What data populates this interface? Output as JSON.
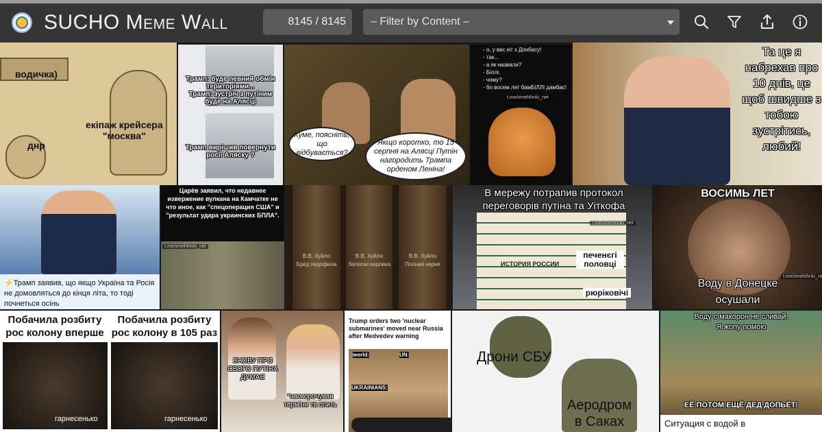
{
  "header": {
    "title": "SUCHO Meme Wall",
    "counter": "8145 / 8145",
    "filter_placeholder": "– Filter by Content –",
    "icons": [
      "search-icon",
      "filter-icon",
      "share-icon",
      "info-icon"
    ]
  },
  "colors": {
    "header_bg": "#353535",
    "control_bg": "#5a5a5a",
    "page_bg": "#1a1a1a"
  },
  "memes": {
    "m1": {
      "l1": "водичка)",
      "l2": "екіпаж крейсера\n\"москва\"",
      "l3": "днр"
    },
    "m2": {
      "top": "Трамп: буде певний обмін територіями...\nТрамп: зустріч з путіним буде на Алясці",
      "bottom": "Трамп вирішив повернути росії Аляску ?"
    },
    "m3": {
      "left": "Куме, поясніть, що відбувається?",
      "right": "Якщо коротко, то 15 серпня на Алясці Путін нагородить Трампа орденом Леніна!"
    },
    "m4": {
      "text": "- о, у вас кіт з Донбасу!\n- так...\n- а як назвали?\n- Біллі.\n- чому?\n- бо восем лет бамБІЛЛІ дамбас!"
    },
    "m5": {
      "text": "Та це я набрехав про 10 днів, це щоб швидше з тобою зустрітись, любий!"
    },
    "m6": {
      "text": "⚡Трамп заявив, що якщо Україна та Росія не домовляться до кінця літа, то тоді почнеться осінь"
    },
    "m7": {
      "text": "Царёв заявил, что недавнее извержение вулкана на Камчатке не что иное, как \"спецоперация США\" и \"результат удара украинских БПЛА\"."
    },
    "m8": {
      "b1": "В.В. Хуйло\nБред педофила",
      "b2": "В.В. Хуйло\nЗаписки карлика",
      "b3": "В.В. Хуйло\nПолная херня"
    },
    "m9": {
      "title": "В мережу потрапив протокол переговорів путіна та Уіткофа",
      "l1": "печенєгі\nполовці",
      "l2": "рюріковічі",
      "spine": "ИСТОРИЯ РОССИИ"
    },
    "m10": {
      "top": "ВОСИМЬ ЛЕТ",
      "bottom": "Воду в Донецке\nосушали"
    },
    "m11": {
      "left": "Побачила розбиту рос колону вперше",
      "right": "Побачила розбиту рос колону в 105 раз",
      "sub": "гарнесенько"
    },
    "m12": {
      "left": "ЗНОВУ ПРО СВОГО ПУТІНА ДУМАЄ",
      "right": "*наскорочував терміни та спить"
    },
    "m13": {
      "headline": "Trump orders two 'nuclear submarines' moved near Russia after Medvedev warning",
      "l1": "world:",
      "l2": "UN:",
      "l3": "UKRAINIANS:"
    },
    "m14": {
      "top": "Дрони СБУ",
      "bottom": "Аеродром\nв Саках"
    },
    "m15": {
      "top": "Воду с макорон не сливай.\nЯ жопу помою",
      "bottom": "ЕЁ ПОТОМ ЕЩЁ ДЕД ДОПЬЁТ!",
      "caption": "Ситуация с водой в"
    },
    "watermark": "t.me/smehihnki_net"
  }
}
